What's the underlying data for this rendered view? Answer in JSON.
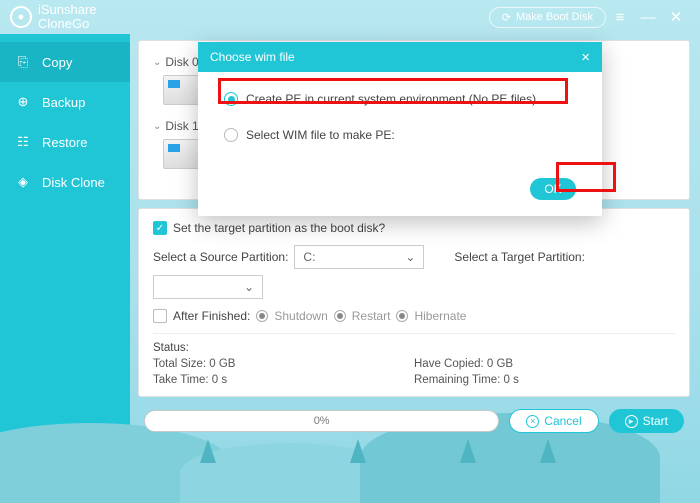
{
  "app": {
    "brand1": "iSunshare",
    "brand2": "CloneGo"
  },
  "topbar": {
    "make_boot": "Make Boot Disk"
  },
  "sidebar": {
    "items": [
      {
        "label": "Copy"
      },
      {
        "label": "Backup"
      },
      {
        "label": "Restore"
      },
      {
        "label": "Disk Clone"
      }
    ]
  },
  "disks": {
    "d0": "Disk 0",
    "d1": "Disk 1"
  },
  "dialog": {
    "title": "Choose wim file",
    "opt1": "Create PE in current system environment (No PE files)",
    "opt2": "Select WIM file to make PE:",
    "ok": "OK"
  },
  "options": {
    "set_target": "Set the target partition as the boot disk?",
    "select_source": "Select a Source Partition:",
    "source_value": "C:",
    "select_target": "Select a Target Partition:",
    "after_finished": "After Finished:",
    "shutdown": "Shutdown",
    "restart": "Restart",
    "hibernate": "Hibernate"
  },
  "status": {
    "title": "Status:",
    "total": "Total Size: 0 GB",
    "copied": "Have Copied: 0 GB",
    "take": "Take Time: 0 s",
    "remain": "Remaining Time: 0 s"
  },
  "footer": {
    "progress": "0%",
    "cancel": "Cancel",
    "start": "Start"
  }
}
